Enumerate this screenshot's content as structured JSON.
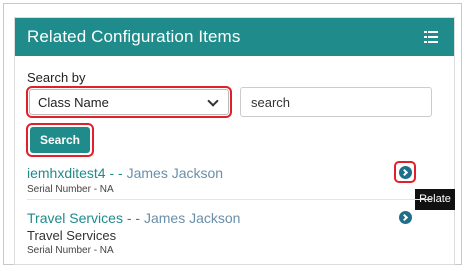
{
  "panel": {
    "title": "Related Configuration Items"
  },
  "search": {
    "label": "Search by",
    "selected": "Class Name",
    "value": "search",
    "button_label": "Search"
  },
  "items": [
    {
      "name": "iemhxditest4",
      "sep": " - - ",
      "owner": "James Jackson",
      "subtitle": "",
      "serial": "Serial Number - NA"
    },
    {
      "name": "Travel Services",
      "sep": " - - ",
      "owner": "James Jackson",
      "subtitle": "Travel Services",
      "serial": "Serial Number - NA"
    }
  ],
  "tooltip": {
    "text": "Relate"
  },
  "colors": {
    "accent": "#1f8b8b",
    "highlight": "#e0202a",
    "action_icon": "#1f6f8b"
  }
}
